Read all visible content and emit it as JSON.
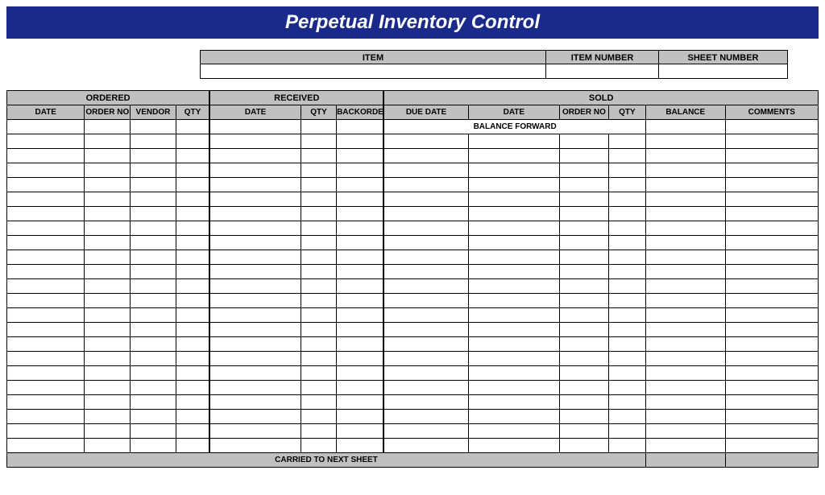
{
  "title": "Perpetual Inventory Control",
  "info": {
    "item_label": "ITEM",
    "item_value": "",
    "item_number_label": "ITEM NUMBER",
    "item_number_value": "",
    "sheet_number_label": "SHEET NUMBER",
    "sheet_number_value": ""
  },
  "groups": {
    "ordered": "ORDERED",
    "received": "RECEIVED",
    "sold": "SOLD"
  },
  "columns": {
    "ordered_date": "DATE",
    "order_no": "ORDER NO",
    "vendor": "VENDOR",
    "ordered_qty": "QTY",
    "received_date": "DATE",
    "received_qty": "QTY",
    "backorder": "BACKORDER",
    "due_date": "DUE DATE",
    "sold_date": "DATE",
    "sold_order_no": "ORDER NO",
    "sold_qty": "QTY",
    "balance": "BALANCE",
    "comments": "COMMENTS"
  },
  "balance_forward_label": "BALANCE FORWARD",
  "balance_forward_value": "",
  "footer_label": "CARRIED TO NEXT SHEET",
  "footer_value": "",
  "rows": [
    {},
    {},
    {},
    {},
    {},
    {},
    {},
    {},
    {},
    {},
    {},
    {},
    {},
    {},
    {},
    {},
    {},
    {},
    {},
    {},
    {},
    {}
  ]
}
